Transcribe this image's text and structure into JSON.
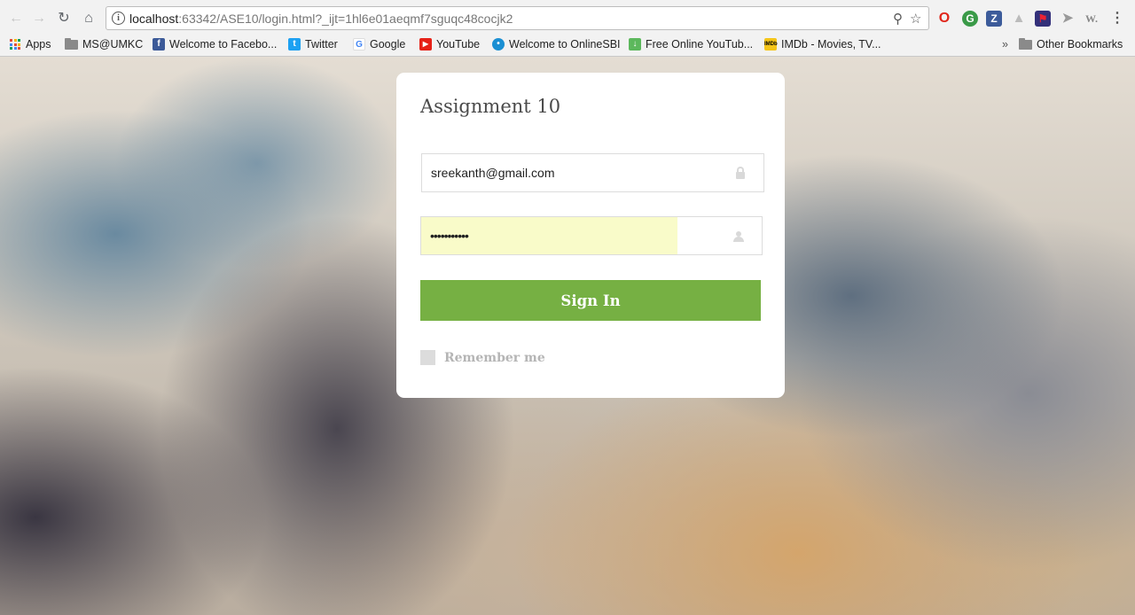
{
  "browser": {
    "url_host": "localhost",
    "url_rest": ":63342/ASE10/login.html?_ijt=1hl6e01aeqmf7sguqc48cocjk2",
    "bookmarks": [
      {
        "label": "Apps",
        "icon": "apps-grid-icon"
      },
      {
        "label": "MS@UMKC",
        "icon": "folder-icon"
      },
      {
        "label": "Welcome to Facebo...",
        "icon": "facebook-icon",
        "color": "#3b5998"
      },
      {
        "label": "Twitter",
        "icon": "twitter-icon",
        "color": "#1da1f2"
      },
      {
        "label": "Google",
        "icon": "google-icon",
        "color": "#4285f4"
      },
      {
        "label": "YouTube",
        "icon": "youtube-icon",
        "color": "#e62117"
      },
      {
        "label": "Welcome to OnlineSBI",
        "icon": "sbi-icon",
        "color": "#1a8fd3"
      },
      {
        "label": "Free Online YouTub...",
        "icon": "download-icon",
        "color": "#5cb85c"
      },
      {
        "label": "IMDb - Movies, TV...",
        "icon": "imdb-icon",
        "color": "#f5c518"
      }
    ],
    "overflow_label": "»",
    "other_bookmarks": "Other Bookmarks"
  },
  "login": {
    "title": "Assignment 10",
    "email_value": "sreekanth@gmail.com",
    "password_value": "•••••••••••",
    "signin_label": "Sign In",
    "remember_label": "Remember me"
  },
  "colors": {
    "signin_button": "#76b043",
    "autofill": "#f9fbc9"
  }
}
